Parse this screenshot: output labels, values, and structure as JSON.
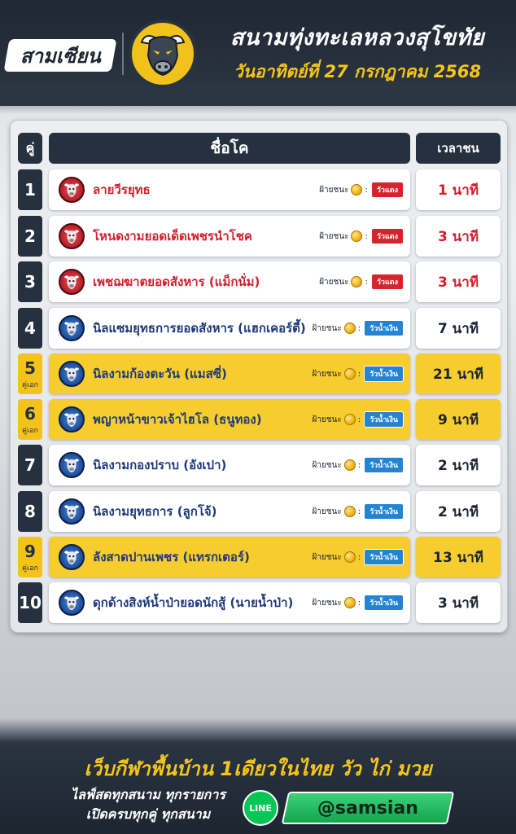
{
  "header": {
    "brand": "สามเซียน",
    "title": "สนามทุ่งทะเลหลวงสุโขทัย",
    "date": "วันอาทิตย์ที่ 27 กรกฎาคม 2568"
  },
  "table": {
    "col_pair": "คู่",
    "col_name": "ชื่อโค",
    "col_time": "เวลาชน",
    "winner_label": "ฝ้ายชนะ",
    "rows": [
      {
        "num": "1",
        "sub": "",
        "name": "ลายวีรยุทธ",
        "badge": "วัวแดง",
        "time": "1 นาที",
        "color": "red"
      },
      {
        "num": "2",
        "sub": "",
        "name": "โหนดงามยอดเด็ดเพชรนำโชค",
        "badge": "วัวแดง",
        "time": "3 นาที",
        "color": "red"
      },
      {
        "num": "3",
        "sub": "",
        "name": "เพชฌฆาตยอดสังหาร (แม็กนั่ม)",
        "badge": "วัวแดง",
        "time": "3 นาที",
        "color": "red"
      },
      {
        "num": "4",
        "sub": "",
        "name": "นิลแซมยุทธการยอดสังหาร (แฮกเคอร์ตี้)",
        "badge": "วัวน้ำเงิน",
        "time": "7 นาที",
        "color": "blue"
      },
      {
        "num": "5",
        "sub": "คู่เอก",
        "name": "นิลงามก้องตะวัน (แมสซี่)",
        "badge": "วัวน้ำเงิน",
        "time": "21 นาที",
        "color": "blue"
      },
      {
        "num": "6",
        "sub": "คู่เอก",
        "name": "พญาหน้าขาวเจ้าไฮโล (ธนูทอง)",
        "badge": "วัวน้ำเงิน",
        "time": "9 นาที",
        "color": "blue"
      },
      {
        "num": "7",
        "sub": "",
        "name": "นิลงามกองปราบ (อังเปา)",
        "badge": "วัวน้ำเงิน",
        "time": "2 นาที",
        "color": "blue"
      },
      {
        "num": "8",
        "sub": "",
        "name": "นิลงามยุทธการ (ลูกโจ้)",
        "badge": "วัวน้ำเงิน",
        "time": "2 นาที",
        "color": "blue"
      },
      {
        "num": "9",
        "sub": "คู่เอก",
        "name": "ลังสาดปานเพชร (แทรกเตอร์)",
        "badge": "วัวน้ำเงิน",
        "time": "13 นาที",
        "color": "blue"
      },
      {
        "num": "10",
        "sub": "",
        "name": "ดุกด้างสิงห์น้ำป่ายอดนักสู้ (นายน้ำป่า)",
        "badge": "วัวน้ำเงิน",
        "time": "3 นาที",
        "color": "blue"
      }
    ]
  },
  "footer": {
    "tagline": "เว็บกีฬาพื้นบ้าน 1เดียวในไทย วัว ไก่ มวย",
    "promo_line1": "ไลฟ์สดทุกสนาม ทุกรายการ",
    "promo_line2": "เปิดครบทุกคู่ ทุกสนาม",
    "line_label": "LINE",
    "handle": "@samsian"
  },
  "colors": {
    "navy": "#263140",
    "gold": "#f5c518",
    "red": "#d21f2c",
    "blue": "#1f3a7a",
    "line_green": "#06c755"
  }
}
